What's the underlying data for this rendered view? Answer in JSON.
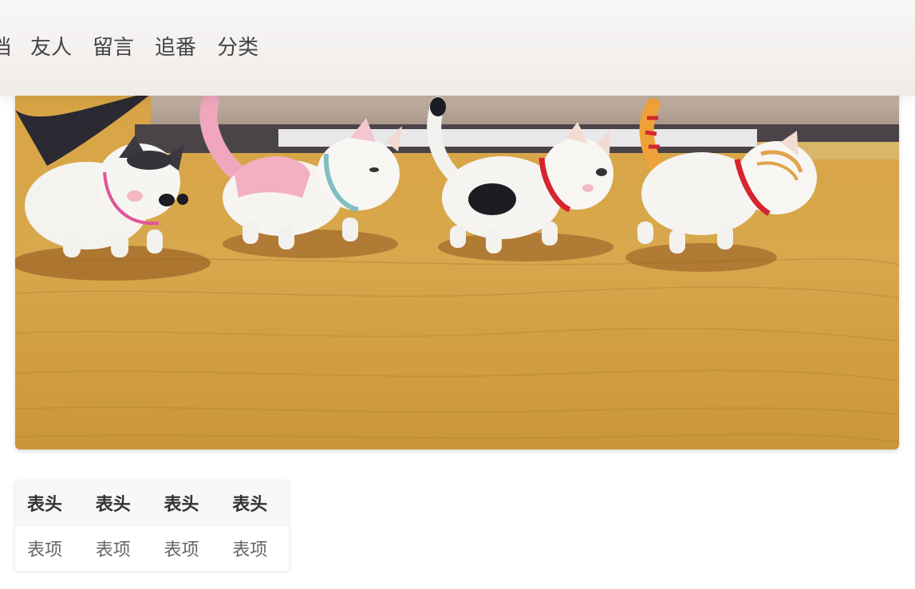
{
  "nav": {
    "items": [
      {
        "label": "档",
        "partial": true
      },
      {
        "label": "友人"
      },
      {
        "label": "留言"
      },
      {
        "label": "追番"
      },
      {
        "label": "分类"
      }
    ]
  },
  "table": {
    "headers": [
      "表头",
      "表头",
      "表头",
      "表头"
    ],
    "rows": [
      [
        "表项",
        "表项",
        "表项",
        "表项"
      ]
    ]
  },
  "colors": {
    "nav_background": "#f3f0ee",
    "nav_text": "#444444",
    "table_header_bg": "#f7f7f7",
    "table_header_text": "#333333",
    "table_cell_text": "#666666"
  }
}
